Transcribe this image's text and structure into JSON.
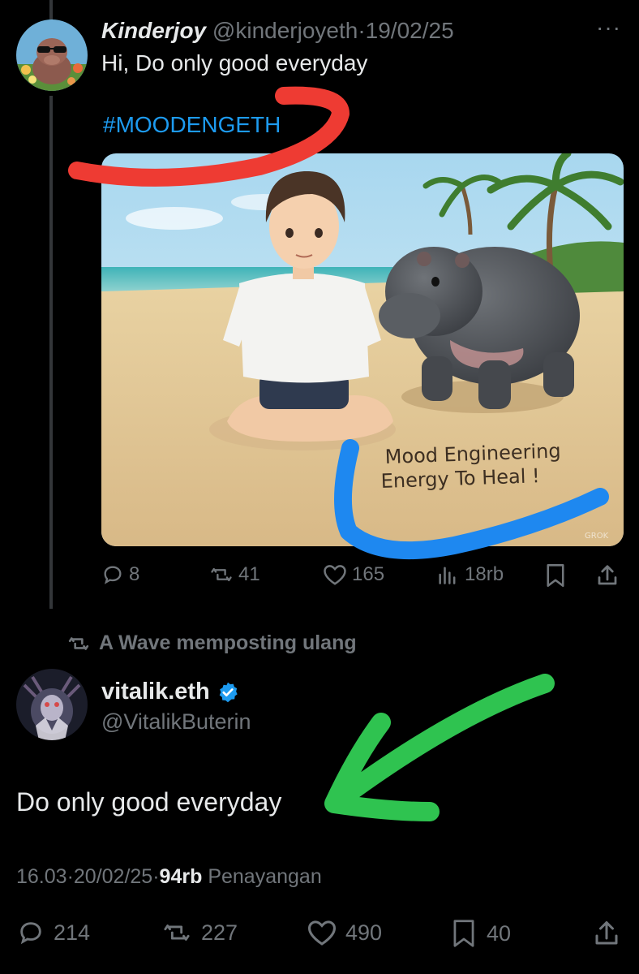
{
  "post1": {
    "display_name": "Kinderjoy",
    "handle": "@kinderjoyeth",
    "separator": "·",
    "date": "19/02/25",
    "more": "···",
    "text": "Hi, Do only good everyday",
    "hashtag": "#MOODENGETH",
    "image_caption_line1": "Mood Engineering",
    "image_caption_line2": "Energy To Heal !",
    "image_watermark": "GROK",
    "actions": {
      "replies": "8",
      "reposts": "41",
      "likes": "165",
      "views": "18rb"
    }
  },
  "repost_note": "A Wave memposting ulang",
  "post2": {
    "display_name": "vitalik.eth",
    "handle": "@VitalikButerin",
    "text": "Do only good everyday",
    "time": "16.03",
    "date": "20/02/25",
    "separator": "·",
    "views_count": "94rb",
    "views_label": "Penayangan",
    "actions": {
      "replies": "214",
      "reposts": "227",
      "likes": "490",
      "bookmarks": "40"
    }
  },
  "colors": {
    "background": "#000000",
    "text": "#e7e9ea",
    "muted": "#71767b",
    "link": "#1d9bf0",
    "verified": "#1d9bf0",
    "annotation_red": "#ee3b33",
    "annotation_blue": "#1e88f0",
    "annotation_green": "#2fc350"
  }
}
